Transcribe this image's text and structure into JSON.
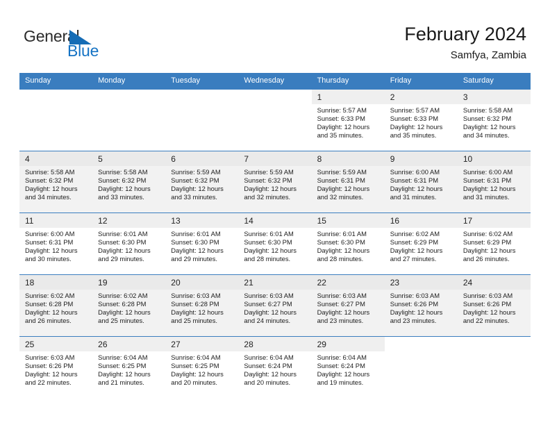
{
  "brand": {
    "name_part1": "General",
    "name_part2": "Blue",
    "accent_color": "#1573c4",
    "triangle_color": "#156cb5"
  },
  "header": {
    "title": "February 2024",
    "subtitle": "Samfya, Zambia"
  },
  "calendar": {
    "header_bg": "#3a7dbf",
    "weekdays": [
      "Sunday",
      "Monday",
      "Tuesday",
      "Wednesday",
      "Thursday",
      "Friday",
      "Saturday"
    ],
    "weeks": [
      [
        {
          "day": "",
          "sunrise": "",
          "sunset": "",
          "daylight_line1": "",
          "daylight_line2": ""
        },
        {
          "day": "",
          "sunrise": "",
          "sunset": "",
          "daylight_line1": "",
          "daylight_line2": ""
        },
        {
          "day": "",
          "sunrise": "",
          "sunset": "",
          "daylight_line1": "",
          "daylight_line2": ""
        },
        {
          "day": "",
          "sunrise": "",
          "sunset": "",
          "daylight_line1": "",
          "daylight_line2": ""
        },
        {
          "day": "1",
          "sunrise": "Sunrise: 5:57 AM",
          "sunset": "Sunset: 6:33 PM",
          "daylight_line1": "Daylight: 12 hours",
          "daylight_line2": "and 35 minutes."
        },
        {
          "day": "2",
          "sunrise": "Sunrise: 5:57 AM",
          "sunset": "Sunset: 6:33 PM",
          "daylight_line1": "Daylight: 12 hours",
          "daylight_line2": "and 35 minutes."
        },
        {
          "day": "3",
          "sunrise": "Sunrise: 5:58 AM",
          "sunset": "Sunset: 6:32 PM",
          "daylight_line1": "Daylight: 12 hours",
          "daylight_line2": "and 34 minutes."
        }
      ],
      [
        {
          "day": "4",
          "sunrise": "Sunrise: 5:58 AM",
          "sunset": "Sunset: 6:32 PM",
          "daylight_line1": "Daylight: 12 hours",
          "daylight_line2": "and 34 minutes."
        },
        {
          "day": "5",
          "sunrise": "Sunrise: 5:58 AM",
          "sunset": "Sunset: 6:32 PM",
          "daylight_line1": "Daylight: 12 hours",
          "daylight_line2": "and 33 minutes."
        },
        {
          "day": "6",
          "sunrise": "Sunrise: 5:59 AM",
          "sunset": "Sunset: 6:32 PM",
          "daylight_line1": "Daylight: 12 hours",
          "daylight_line2": "and 33 minutes."
        },
        {
          "day": "7",
          "sunrise": "Sunrise: 5:59 AM",
          "sunset": "Sunset: 6:32 PM",
          "daylight_line1": "Daylight: 12 hours",
          "daylight_line2": "and 32 minutes."
        },
        {
          "day": "8",
          "sunrise": "Sunrise: 5:59 AM",
          "sunset": "Sunset: 6:31 PM",
          "daylight_line1": "Daylight: 12 hours",
          "daylight_line2": "and 32 minutes."
        },
        {
          "day": "9",
          "sunrise": "Sunrise: 6:00 AM",
          "sunset": "Sunset: 6:31 PM",
          "daylight_line1": "Daylight: 12 hours",
          "daylight_line2": "and 31 minutes."
        },
        {
          "day": "10",
          "sunrise": "Sunrise: 6:00 AM",
          "sunset": "Sunset: 6:31 PM",
          "daylight_line1": "Daylight: 12 hours",
          "daylight_line2": "and 31 minutes."
        }
      ],
      [
        {
          "day": "11",
          "sunrise": "Sunrise: 6:00 AM",
          "sunset": "Sunset: 6:31 PM",
          "daylight_line1": "Daylight: 12 hours",
          "daylight_line2": "and 30 minutes."
        },
        {
          "day": "12",
          "sunrise": "Sunrise: 6:01 AM",
          "sunset": "Sunset: 6:30 PM",
          "daylight_line1": "Daylight: 12 hours",
          "daylight_line2": "and 29 minutes."
        },
        {
          "day": "13",
          "sunrise": "Sunrise: 6:01 AM",
          "sunset": "Sunset: 6:30 PM",
          "daylight_line1": "Daylight: 12 hours",
          "daylight_line2": "and 29 minutes."
        },
        {
          "day": "14",
          "sunrise": "Sunrise: 6:01 AM",
          "sunset": "Sunset: 6:30 PM",
          "daylight_line1": "Daylight: 12 hours",
          "daylight_line2": "and 28 minutes."
        },
        {
          "day": "15",
          "sunrise": "Sunrise: 6:01 AM",
          "sunset": "Sunset: 6:30 PM",
          "daylight_line1": "Daylight: 12 hours",
          "daylight_line2": "and 28 minutes."
        },
        {
          "day": "16",
          "sunrise": "Sunrise: 6:02 AM",
          "sunset": "Sunset: 6:29 PM",
          "daylight_line1": "Daylight: 12 hours",
          "daylight_line2": "and 27 minutes."
        },
        {
          "day": "17",
          "sunrise": "Sunrise: 6:02 AM",
          "sunset": "Sunset: 6:29 PM",
          "daylight_line1": "Daylight: 12 hours",
          "daylight_line2": "and 26 minutes."
        }
      ],
      [
        {
          "day": "18",
          "sunrise": "Sunrise: 6:02 AM",
          "sunset": "Sunset: 6:28 PM",
          "daylight_line1": "Daylight: 12 hours",
          "daylight_line2": "and 26 minutes."
        },
        {
          "day": "19",
          "sunrise": "Sunrise: 6:02 AM",
          "sunset": "Sunset: 6:28 PM",
          "daylight_line1": "Daylight: 12 hours",
          "daylight_line2": "and 25 minutes."
        },
        {
          "day": "20",
          "sunrise": "Sunrise: 6:03 AM",
          "sunset": "Sunset: 6:28 PM",
          "daylight_line1": "Daylight: 12 hours",
          "daylight_line2": "and 25 minutes."
        },
        {
          "day": "21",
          "sunrise": "Sunrise: 6:03 AM",
          "sunset": "Sunset: 6:27 PM",
          "daylight_line1": "Daylight: 12 hours",
          "daylight_line2": "and 24 minutes."
        },
        {
          "day": "22",
          "sunrise": "Sunrise: 6:03 AM",
          "sunset": "Sunset: 6:27 PM",
          "daylight_line1": "Daylight: 12 hours",
          "daylight_line2": "and 23 minutes."
        },
        {
          "day": "23",
          "sunrise": "Sunrise: 6:03 AM",
          "sunset": "Sunset: 6:26 PM",
          "daylight_line1": "Daylight: 12 hours",
          "daylight_line2": "and 23 minutes."
        },
        {
          "day": "24",
          "sunrise": "Sunrise: 6:03 AM",
          "sunset": "Sunset: 6:26 PM",
          "daylight_line1": "Daylight: 12 hours",
          "daylight_line2": "and 22 minutes."
        }
      ],
      [
        {
          "day": "25",
          "sunrise": "Sunrise: 6:03 AM",
          "sunset": "Sunset: 6:26 PM",
          "daylight_line1": "Daylight: 12 hours",
          "daylight_line2": "and 22 minutes."
        },
        {
          "day": "26",
          "sunrise": "Sunrise: 6:04 AM",
          "sunset": "Sunset: 6:25 PM",
          "daylight_line1": "Daylight: 12 hours",
          "daylight_line2": "and 21 minutes."
        },
        {
          "day": "27",
          "sunrise": "Sunrise: 6:04 AM",
          "sunset": "Sunset: 6:25 PM",
          "daylight_line1": "Daylight: 12 hours",
          "daylight_line2": "and 20 minutes."
        },
        {
          "day": "28",
          "sunrise": "Sunrise: 6:04 AM",
          "sunset": "Sunset: 6:24 PM",
          "daylight_line1": "Daylight: 12 hours",
          "daylight_line2": "and 20 minutes."
        },
        {
          "day": "29",
          "sunrise": "Sunrise: 6:04 AM",
          "sunset": "Sunset: 6:24 PM",
          "daylight_line1": "Daylight: 12 hours",
          "daylight_line2": "and 19 minutes."
        },
        {
          "day": "",
          "sunrise": "",
          "sunset": "",
          "daylight_line1": "",
          "daylight_line2": ""
        },
        {
          "day": "",
          "sunrise": "",
          "sunset": "",
          "daylight_line1": "",
          "daylight_line2": ""
        }
      ]
    ]
  }
}
